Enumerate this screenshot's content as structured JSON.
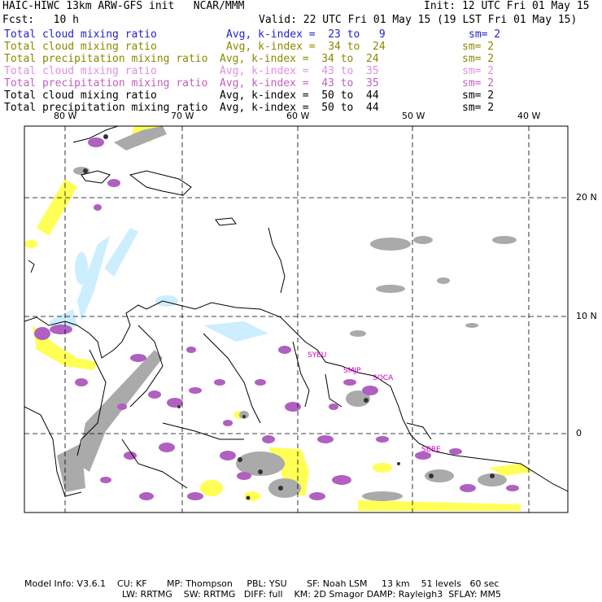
{
  "header": {
    "title_left": "HAIC-HIWC 13km ARW-GFS init   NCAR/MMM",
    "init": "Init: 12 UTC Fri 01 May 15",
    "fcst": "Fcst:   10 h",
    "valid": "Valid: 22 UTC Fri 01 May 15 (19 LST Fri 01 May 15)"
  },
  "legend": [
    {
      "field": "Total cloud mixing ratio",
      "desc": "Avg, k-index =  23 to   9",
      "sm": "sm= 2",
      "color": "#2222cc"
    },
    {
      "field": "Total cloud mixing ratio",
      "desc": "Avg, k-index =  34 to  24",
      "sm": "sm= 2",
      "color": "#8a8a00"
    },
    {
      "field": "Total precipitation mixing ratio",
      "desc": "Avg, k-index =  34 to  24",
      "sm": "sm= 2",
      "color": "#8a8a00"
    },
    {
      "field": "Total cloud mixing ratio",
      "desc": "Avg, k-index =  43 to  35",
      "sm": "sm= 2",
      "color": "#e08fe0"
    },
    {
      "field": "Total precipitation mixing ratio",
      "desc": "Avg, k-index =  43 to  35",
      "sm": "sm= 2",
      "color": "#c060c0"
    },
    {
      "field": "Total cloud mixing ratio",
      "desc": "Avg, k-index =  50 to  44",
      "sm": "sm= 2",
      "color": "#000000"
    },
    {
      "field": "Total precipitation mixing ratio",
      "desc": "Avg, k-index =  50 to  44",
      "sm": "sm= 2",
      "color": "#000000"
    }
  ],
  "map": {
    "lon_labels": [
      "80 W",
      "70 W",
      "60 W",
      "50 W",
      "40 W"
    ],
    "lat_labels": [
      "20 N",
      "10 N",
      "0"
    ],
    "stations": [
      "SYEU",
      "SMJP",
      "SOCA",
      "SBBE"
    ],
    "colors": {
      "high_cloud": "#cceeff",
      "mid_cloud": "#ffff55",
      "high_precip": "#b060c0",
      "gray_cloud": "#aaaaaa",
      "core": "#333333"
    }
  },
  "footer": {
    "line1": "Model Info: V3.6.1    CU: KF       MP: Thompson     PBL: YSU       SF: Noah LSM     13 km    51 levels   60 sec",
    "line2": "LW: RRTMG    SW: RRTMG   DIFF: full    KM: 2D Smagor DAMP: Rayleigh3  SFLAY: MM5"
  }
}
